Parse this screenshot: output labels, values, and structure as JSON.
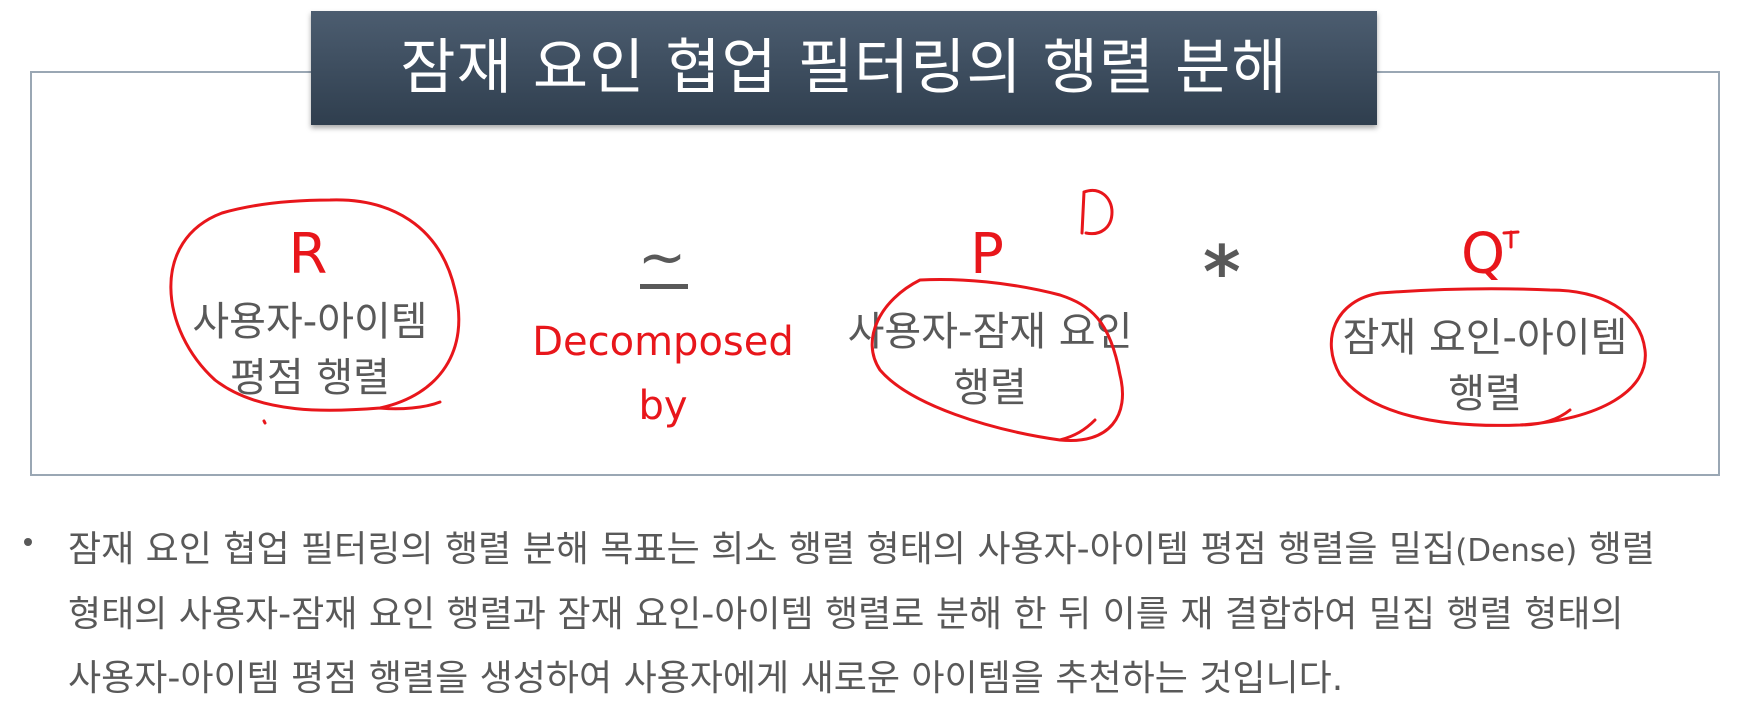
{
  "title": "잠재 요인 협업 필터링의 행렬 분해",
  "equation": {
    "r": {
      "letter": "R",
      "label_line1": "사용자-아이템",
      "label_line2": "평점 행렬"
    },
    "approx_symbol": "~",
    "decomposed_line1": "Decomposed",
    "decomposed_line2": "by",
    "p": {
      "letter": "P",
      "label_line1": "사용자-잠재 요인",
      "label_line2": "행렬"
    },
    "multiply_symbol": "*",
    "q": {
      "letter": "Q",
      "label_line1": "잠재 요인-아이템",
      "label_line2": "행렬"
    }
  },
  "bullet": {
    "line1_part1": "잠재 요인 협업 필터링의 행렬 분해 목표는 희소 행렬 형태의 사용자-아이템 평점 행렬을 밀집",
    "line1_part2": "(Dense)",
    "line1_part3": " 행렬",
    "line2": "형태의 사용자-잠재 요인 행렬과 잠재 요인-아이템 행렬로 분해 한 뒤 이를 재 결합하여 밀집 행렬 형태의",
    "line3": "사용자-아이템 평점 행렬을 생성하여 사용자에게 새로운 아이템을 추천하는 것입니다."
  },
  "colors": {
    "accent_red": "#e8161b",
    "text_gray": "#595959",
    "banner": "#3b4a5a",
    "frame": "#9aa7b4"
  }
}
